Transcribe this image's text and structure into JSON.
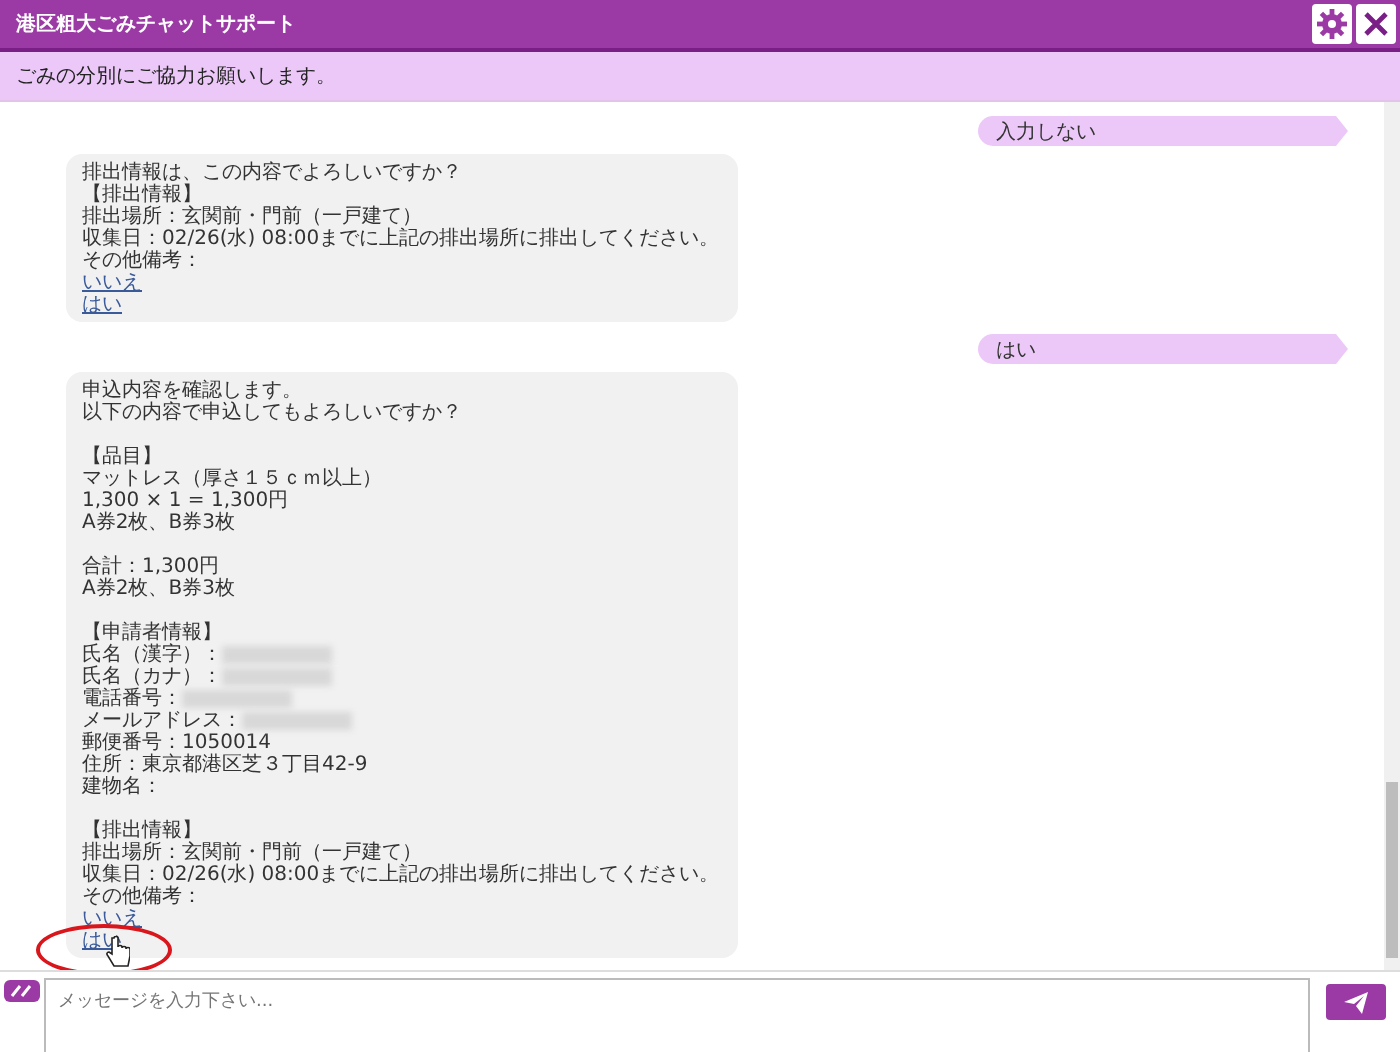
{
  "header": {
    "title": "港区粗大ごみチャットサポート"
  },
  "notice": "ごみの分別にご協力お願いします。",
  "messages": [
    {
      "kind": "user",
      "text": "入力しない"
    },
    {
      "kind": "bot",
      "paragraphs": [
        [
          {
            "text": "排出情報は、この内容でよろしいですか？",
            "redacted": false
          },
          {
            "text": "【排出情報】",
            "redacted": false
          },
          {
            "text": "排出場所：玄関前・門前（一戸建て）",
            "redacted": false
          },
          {
            "text": "収集日：02/26(水) 08:00までに上記の排出場所に排出してください。",
            "redacted": false
          },
          {
            "text": "その他備考：",
            "redacted": false
          }
        ]
      ],
      "links": [
        "いいえ",
        "はい"
      ],
      "highlighted": false
    },
    {
      "kind": "user",
      "text": "はい"
    },
    {
      "kind": "bot",
      "paragraphs": [
        [
          {
            "text": "申込内容を確認します。",
            "redacted": false
          },
          {
            "text": "以下の内容で申込してもよろしいですか？",
            "redacted": false
          }
        ],
        [
          {
            "text": "【品目】",
            "redacted": false
          },
          {
            "text": "マットレス（厚さ１５ｃｍ以上）",
            "redacted": false
          },
          {
            "text": "1,300 × 1 = 1,300円",
            "redacted": false
          },
          {
            "text": "A券2枚、B券3枚",
            "redacted": false
          }
        ],
        [
          {
            "text": "合計：1,300円",
            "redacted": false
          },
          {
            "text": "A券2枚、B券3枚",
            "redacted": false
          }
        ],
        [
          {
            "text": "【申請者情報】",
            "redacted": false
          },
          {
            "text": "氏名（漢字）：",
            "redacted": true
          },
          {
            "text": "氏名（カナ）：",
            "redacted": true
          },
          {
            "text": "電話番号：",
            "redacted": true
          },
          {
            "text": "メールアドレス：",
            "redacted": true
          },
          {
            "text": "郵便番号：1050014",
            "redacted": false
          },
          {
            "text": "住所：東京都港区芝３丁目42-9",
            "redacted": false
          },
          {
            "text": "建物名：",
            "redacted": false
          }
        ],
        [
          {
            "text": "【排出情報】",
            "redacted": false
          },
          {
            "text": "排出場所：玄関前・門前（一戸建て）",
            "redacted": false
          },
          {
            "text": "収集日：02/26(水) 08:00までに上記の排出場所に排出してください。",
            "redacted": false
          },
          {
            "text": "その他備考：",
            "redacted": false
          }
        ]
      ],
      "links": [
        "いいえ",
        "はい"
      ],
      "highlighted": true
    }
  ],
  "input": {
    "placeholder": "メッセージを入力下さい..."
  }
}
